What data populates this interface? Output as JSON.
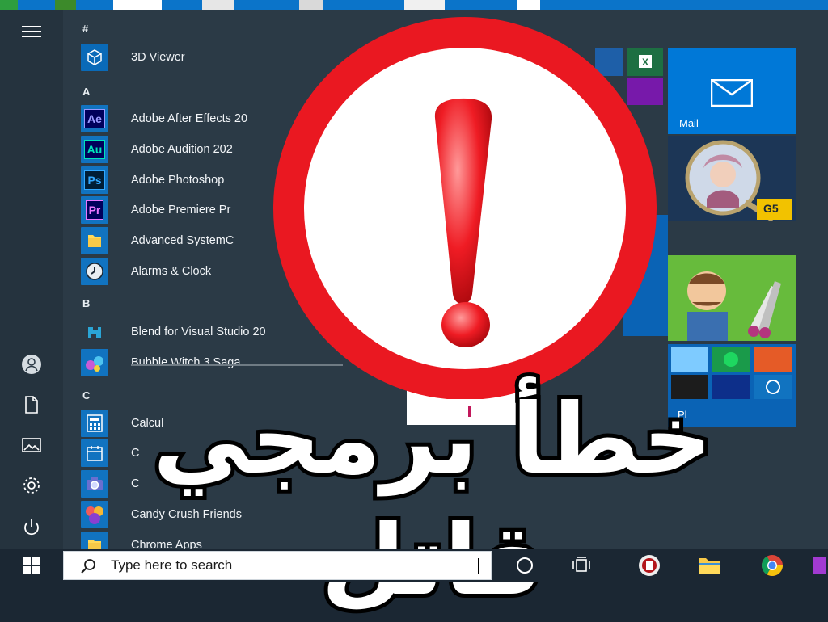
{
  "rail": {
    "icons": [
      "hamburger-icon",
      "user-icon",
      "document-icon",
      "pictures-icon",
      "gear-icon",
      "power-icon"
    ]
  },
  "applist": {
    "letters": [
      "#",
      "A",
      "B",
      "C"
    ],
    "apps": [
      {
        "label": "3D Viewer",
        "icon": "3d-viewer-icon",
        "bg": "#0a6ab8",
        "glyph": "⬡"
      },
      {
        "label": "Adobe After Effects 20",
        "icon": "after-effects-icon",
        "bg": "#00005b",
        "glyph": "Ae"
      },
      {
        "label": "Adobe Audition 202",
        "icon": "audition-icon",
        "bg": "#00005b",
        "glyph": "Au"
      },
      {
        "label": "Adobe Photoshop",
        "icon": "photoshop-icon",
        "bg": "#001e36",
        "glyph": "Ps"
      },
      {
        "label": "Adobe Premiere Pr",
        "icon": "premiere-icon",
        "bg": "#00005b",
        "glyph": "Pr"
      },
      {
        "label": "Advanced SystemC",
        "icon": "folder-icon",
        "bg": "#1173c0",
        "glyph": ""
      },
      {
        "label": "Alarms & Clock",
        "icon": "clock-icon",
        "bg": "#1173c0",
        "glyph": ""
      },
      {
        "label": "Blend for Visual Studio 20",
        "icon": "blend-icon",
        "bg": "#2b3a46",
        "glyph": ""
      },
      {
        "label": "Bubble Witch 3 Saga",
        "icon": "bubble-witch-icon",
        "bg": "#1173c0",
        "glyph": ""
      },
      {
        "label": "Calcul",
        "icon": "calculator-icon",
        "bg": "#1173c0",
        "glyph": ""
      },
      {
        "label": "C",
        "icon": "calendar-icon",
        "bg": "#1173c0",
        "glyph": ""
      },
      {
        "label": "C",
        "icon": "camera-icon",
        "bg": "#1173c0",
        "glyph": ""
      },
      {
        "label": "Candy Crush Friends",
        "icon": "candy-crush-icon",
        "bg": "#1173c0",
        "glyph": ""
      },
      {
        "label": "Chrome Apps",
        "icon": "folder-icon",
        "bg": "#1173c0",
        "glyph": ""
      }
    ]
  },
  "tiles": {
    "mail_label": "Mail",
    "play_label": "Pl",
    "badge_text": "G5"
  },
  "taskbar": {
    "search_placeholder": "Type here to search"
  },
  "overlay": {
    "arabic_title": "خطأ برمجي قاتل",
    "exclamation": "!"
  },
  "colors": {
    "accent": "#0078d7",
    "warning_red": "#e8141a",
    "menu_bg": "#2b3a46"
  }
}
